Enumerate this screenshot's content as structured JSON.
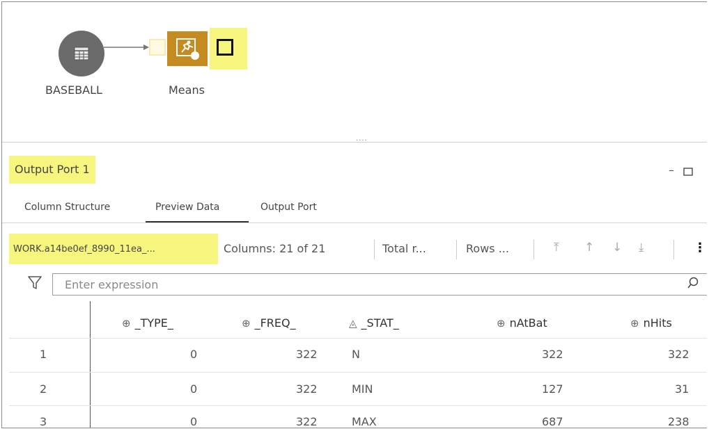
{
  "flow": {
    "source_node_label": "BASEBALL",
    "means_node_label": "Means",
    "source_icon": "table-icon",
    "means_icon": "running-person-icon"
  },
  "panel": {
    "title": "Output Port 1",
    "minimize_icon": "minimize-icon",
    "maximize_icon": "maximize-icon",
    "tabs": [
      {
        "label": "Column Structure"
      },
      {
        "label": "Preview Data"
      },
      {
        "label": "Output Port"
      }
    ],
    "active_tab": "Preview Data"
  },
  "toolbar": {
    "table_name": "WORK.a14be0ef_8990_11ea_...",
    "columns": "Columns: 21 of 21",
    "total_rows": "Total r...",
    "rows": "Rows ...",
    "more_icon": "more-vertical-icon"
  },
  "filter": {
    "placeholder": "Enter expression"
  },
  "grid": {
    "columns": [
      {
        "name": "_TYPE_",
        "type": "numeric"
      },
      {
        "name": "_FREQ_",
        "type": "numeric"
      },
      {
        "name": "_STAT_",
        "type": "character"
      },
      {
        "name": "nAtBat",
        "type": "numeric"
      },
      {
        "name": "nHits",
        "type": "numeric"
      }
    ],
    "rows": [
      {
        "n": "1",
        "type": "0",
        "freq": "322",
        "stat": "N",
        "atbat": "322",
        "hits": "322"
      },
      {
        "n": "2",
        "type": "0",
        "freq": "322",
        "stat": "MIN",
        "atbat": "127",
        "hits": "31"
      },
      {
        "n": "3",
        "type": "0",
        "freq": "322",
        "stat": "MAX",
        "atbat": "687",
        "hits": "238"
      }
    ]
  },
  "colors": {
    "highlight": "#f6f67e",
    "node_gold": "#c58b20",
    "node_gray": "#6b6b6b"
  }
}
